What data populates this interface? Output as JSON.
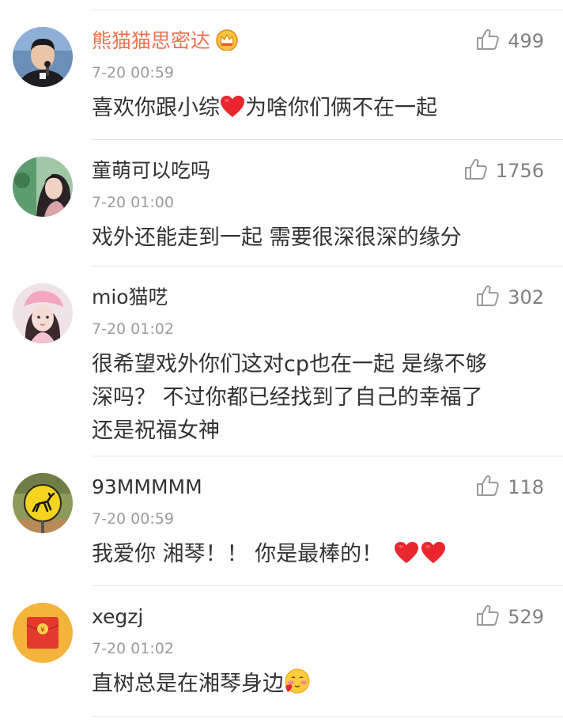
{
  "comments": [
    {
      "username": "熊猫猫思密达",
      "badge_icon": "vip-crown-icon",
      "username_color": "#eb7350",
      "time": "7-20 00:59",
      "text_before": "喜欢你跟小综",
      "emoji": "red-heart-icon",
      "text_after": "为啥你们俩不在一起",
      "likes": "499"
    },
    {
      "username": "童萌可以吃吗",
      "time": "7-20 01:00",
      "text": "戏外还能走到一起 需要很深很深的缘分",
      "likes": "1756"
    },
    {
      "username": "mio猫呓",
      "time": "7-20 01:02",
      "text_lines": [
        "很希望戏外你们这对cp也在一起 是缘不够",
        "深吗？ 不过你都已经找到了自己的幸福了",
        "还是祝福女神"
      ],
      "likes": "302"
    },
    {
      "username": "93MMMMM",
      "time": "7-20 00:59",
      "text": "我爱你 湘琴！！ 你是最棒的！",
      "emoji": [
        "red-heart-icon",
        "red-heart-icon"
      ],
      "likes": "118"
    },
    {
      "username": "xegzj",
      "time": "7-20 01:02",
      "text": "直树总是在湘琴身边",
      "emoji": "shy-face-icon",
      "likes": "529"
    }
  ],
  "colors": {
    "username": "#333333",
    "vip_username": "#eb7350",
    "timestamp": "#9b9b9b",
    "like_count": "#808080",
    "separator": "#e6e6e6",
    "heart": "#e8262d"
  }
}
